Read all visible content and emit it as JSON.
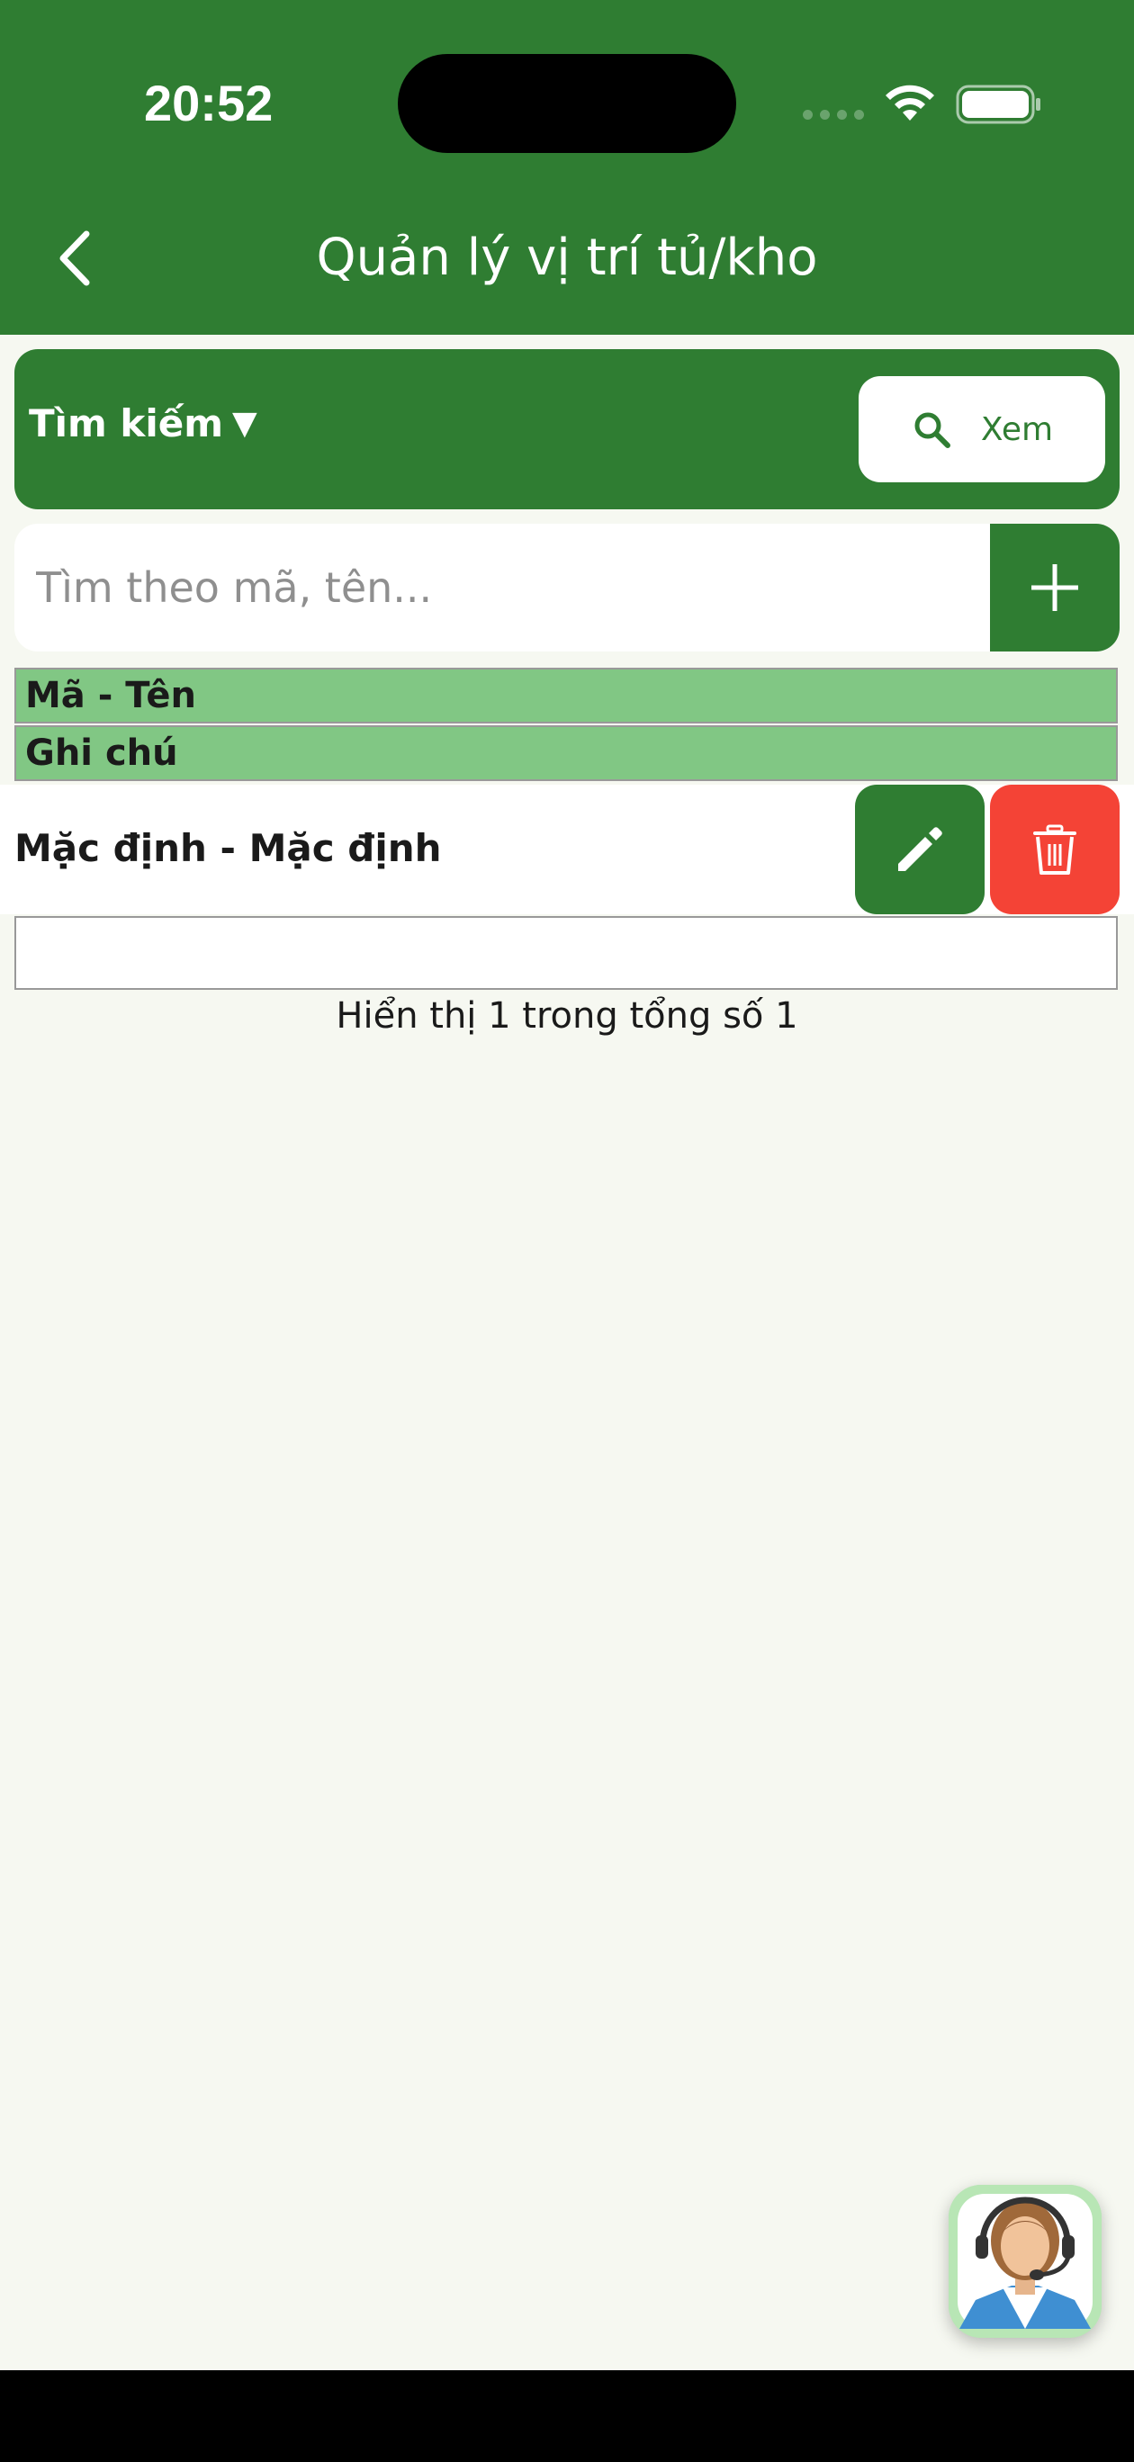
{
  "status_bar": {
    "time": "20:52"
  },
  "header": {
    "title": "Quản lý vị trí tủ/kho"
  },
  "search_panel": {
    "toggle_label": "Tìm kiếm",
    "toggle_caret": "▼",
    "view_button_label": "Xem"
  },
  "search": {
    "placeholder": "Tìm theo mã, tên..."
  },
  "table": {
    "columns": [
      "Mã - Tên",
      "Ghi chú"
    ],
    "rows": [
      {
        "title": "Mặc định - Mặc định",
        "note": ""
      }
    ]
  },
  "pagination": {
    "info": "Hiển thị 1 trong tổng số 1"
  },
  "colors": {
    "primary": "#2f7d32",
    "header_row": "#81c784",
    "delete": "#f44336",
    "background": "#f6f8f1"
  },
  "icons": [
    "back-icon",
    "wifi-icon",
    "battery-icon",
    "search-icon",
    "plus-icon",
    "pencil-icon",
    "trash-icon",
    "support-agent-icon"
  ]
}
